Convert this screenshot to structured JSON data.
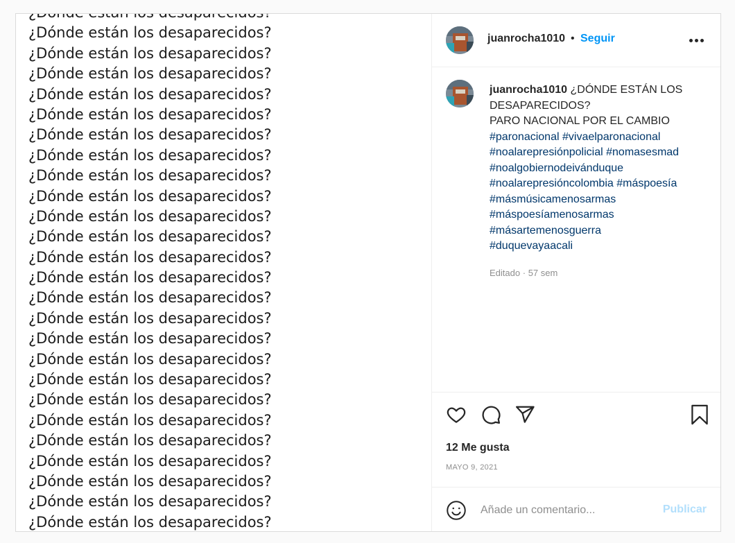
{
  "media": {
    "line_text": "¿Dónde están los desaparecidos?",
    "line_count": 27
  },
  "header": {
    "username": "juanrocha1010",
    "separator": "•",
    "follow_label": "Seguir"
  },
  "caption": {
    "username": "juanrocha1010",
    "title": "¿DÓNDE ESTÁN LOS DESAPARECIDOS?",
    "subtitle": "PARO NACIONAL POR EL CAMBIO",
    "hashtag_lines": [
      [
        "#paronacional",
        "#vivaelparonacional"
      ],
      [
        "#noalarepresiónpolicial",
        "#nomasesmad"
      ],
      [
        "#noalgobiernodeivánduque"
      ],
      [
        "#noalarepresióncolombia",
        "#máspoesía"
      ],
      [
        "#másmúsicamenosarmas"
      ],
      [
        "#máspoesíamenosarmas"
      ],
      [
        "#másartemenosguerra"
      ],
      [
        "#duquevayaacali"
      ]
    ],
    "edited_label": "Editado",
    "edited_sep": "·",
    "edited_time": "57 sem"
  },
  "actions": {
    "likes": "12 Me gusta",
    "date": "MAYO 9, 2021"
  },
  "comment_box": {
    "placeholder": "Añade un comentario...",
    "publish_label": "Publicar"
  },
  "colors": {
    "link_blue": "#0095f6",
    "hashtag": "#00376b",
    "publish_disabled": "#b2dffc",
    "muted": "#8e8e8e",
    "text": "#262626"
  },
  "icons": [
    "more-options-icon",
    "heart-icon",
    "comment-icon",
    "share-icon",
    "bookmark-icon",
    "emoji-icon"
  ]
}
